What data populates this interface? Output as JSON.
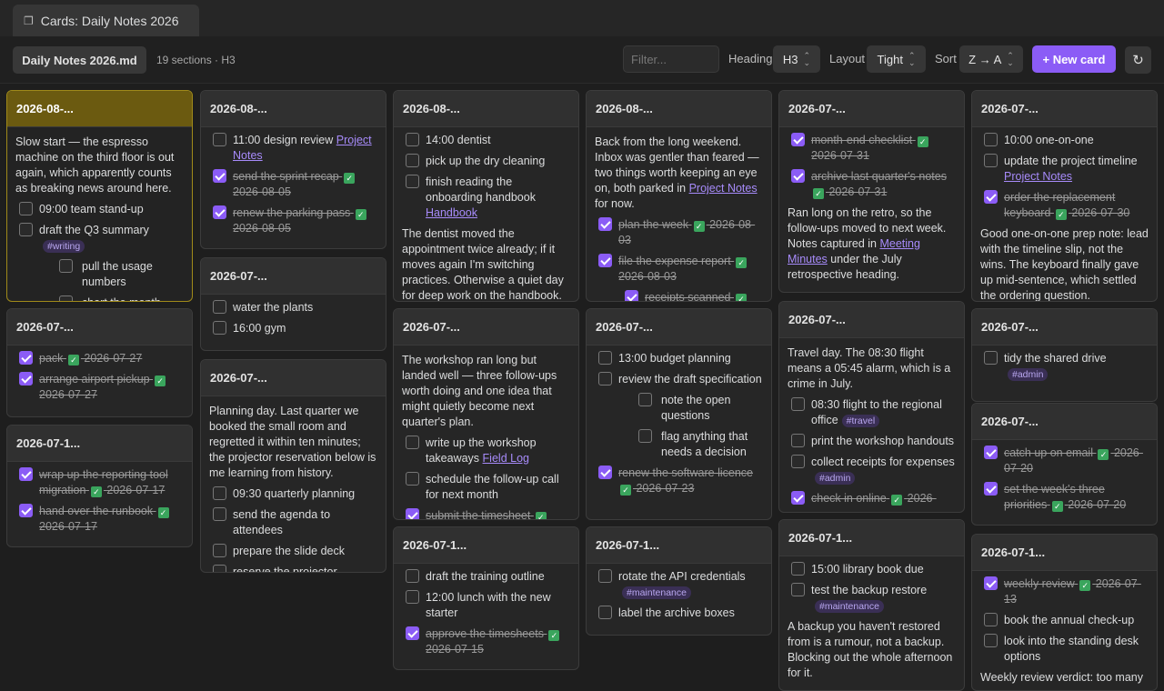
{
  "tab": {
    "icon": "copy-icon",
    "title": "Cards: Daily Notes 2026"
  },
  "toolbar": {
    "file": "Daily Notes 2026.md",
    "meta": "19 sections · H3",
    "filter_placeholder": "Filter...",
    "heading_label": "Heading",
    "heading_value": "H3",
    "layout_label": "Layout",
    "layout_value": "Tight",
    "sort_label": "Sort",
    "sort_value": "Z → A",
    "new_card": "+ New card",
    "refresh_icon": "↻"
  },
  "colors": {
    "accent": "#8b5cf6",
    "selected_head": "#6b5a10",
    "done_check": "#3aa55d"
  },
  "cards": [
    {
      "title": "2026-08-...",
      "selected": true,
      "items": [
        {
          "t": "p",
          "text": "Slow start — the espresso machine on the third floor is out again, which apparently counts as breaking news around here."
        },
        {
          "t": "task",
          "text": "09:00 team stand-up"
        },
        {
          "t": "task",
          "text": "draft the Q3 summary",
          "tag": "#writing"
        },
        {
          "t": "task",
          "lvl": 2,
          "text": "pull the usage numbers"
        },
        {
          "t": "task",
          "lvl": 2,
          "text": "chart the month"
        }
      ]
    },
    {
      "title": "2026-07-...",
      "items": [
        {
          "t": "task",
          "done": true,
          "text": "pack",
          "date": "2026-07-27"
        },
        {
          "t": "task",
          "done": true,
          "text": "arrange airport pickup",
          "date": "2026-07-27"
        }
      ]
    },
    {
      "title": "2026-07-1...",
      "items": [
        {
          "t": "task",
          "done": true,
          "text": "wrap up the reporting tool migration",
          "date": "2026-07-17"
        },
        {
          "t": "task",
          "done": true,
          "text": "hand over the runbook",
          "date": "2026-07-17"
        }
      ]
    },
    {
      "title": "2026-08-...",
      "items": [
        {
          "t": "task",
          "text": "11:00 design review",
          "link": "Project Notes"
        },
        {
          "t": "task",
          "done": true,
          "text": "send the sprint recap",
          "date": "2026-08-05"
        },
        {
          "t": "task",
          "done": true,
          "text": "renew the parking pass",
          "date": "2026-08-05"
        }
      ]
    },
    {
      "title": "2026-07-...",
      "items": [
        {
          "t": "task",
          "text": "water the plants"
        },
        {
          "t": "task",
          "text": "16:00 gym"
        }
      ]
    },
    {
      "title": "2026-07-...",
      "items": [
        {
          "t": "p",
          "text": "Planning day. Last quarter we booked the small room and regretted it within ten minutes; the projector reservation below is me learning from history."
        },
        {
          "t": "task",
          "text": "09:30 quarterly planning"
        },
        {
          "t": "task",
          "text": "send the agenda to attendees"
        },
        {
          "t": "task",
          "text": "prepare the slide deck"
        },
        {
          "t": "task",
          "text": "reserve the projector"
        }
      ]
    },
    {
      "title": "2026-08-...",
      "items": [
        {
          "t": "task",
          "text": "14:00 dentist"
        },
        {
          "t": "task",
          "text": "pick up the dry cleaning"
        },
        {
          "t": "task",
          "text": "finish reading the onboarding handbook",
          "link": "Handbook"
        },
        {
          "t": "p",
          "text": "The dentist moved the appointment twice already; if it moves again I'm switching practices. Otherwise a quiet day for deep work on the handbook."
        }
      ]
    },
    {
      "title": "2026-07-...",
      "items": [
        {
          "t": "p",
          "text": "The workshop ran long but landed well — three follow-ups worth doing and one idea that might quietly become next quarter's plan."
        },
        {
          "t": "task",
          "text": "write up the workshop takeaways",
          "link": "Field Log"
        },
        {
          "t": "task",
          "text": "schedule the follow-up call for next month"
        },
        {
          "t": "task",
          "done": true,
          "text": "submit the timesheet"
        }
      ]
    },
    {
      "title": "2026-07-1...",
      "items": [
        {
          "t": "task",
          "text": "draft the training outline"
        },
        {
          "t": "task",
          "text": "12:00 lunch with the new starter"
        },
        {
          "t": "task",
          "done": true,
          "text": "approve the timesheets",
          "date": "2026-07-15"
        }
      ]
    },
    {
      "title": "2026-08-...",
      "items": [
        {
          "t": "p",
          "text": "Back from the long weekend. Inbox was gentler than feared — two things worth keeping an eye on, both parked in",
          "link": "Project Notes",
          "after": " for now."
        },
        {
          "t": "task",
          "done": true,
          "text": "plan the week",
          "date": "2026-08-03"
        },
        {
          "t": "task",
          "done": true,
          "text": "file the expense report",
          "date": "2026-08-03"
        },
        {
          "t": "task",
          "lvl": 3,
          "done": true,
          "text": "receipts scanned"
        }
      ]
    },
    {
      "title": "2026-07-...",
      "items": [
        {
          "t": "task",
          "text": "13:00 budget planning"
        },
        {
          "t": "task",
          "text": "review the draft specification"
        },
        {
          "t": "task",
          "lvl": 2,
          "text": "note the open questions"
        },
        {
          "t": "task",
          "lvl": 2,
          "text": "flag anything that needs a decision"
        },
        {
          "t": "task",
          "done": true,
          "text": "renew the software licence",
          "date": "2026-07-23"
        }
      ]
    },
    {
      "title": "2026-07-1...",
      "items": [
        {
          "t": "task",
          "text": "rotate the API credentials",
          "tag": "#maintenance"
        },
        {
          "t": "task",
          "text": "label the archive boxes"
        }
      ]
    },
    {
      "title": "2026-07-...",
      "items": [
        {
          "t": "task",
          "done": true,
          "text": "month-end checklist",
          "date": "2026-07-31"
        },
        {
          "t": "task",
          "done": true,
          "text": "archive last quarter's notes",
          "date": "2026-07-31"
        },
        {
          "t": "p",
          "text": "Ran long on the retro, so the follow-ups moved to next week. Notes captured in",
          "link": "Meeting Minutes",
          "after": " under the July retrospective heading."
        }
      ]
    },
    {
      "title": "2026-07-...",
      "items": [
        {
          "t": "p",
          "text": "Travel day. The 08:30 flight means a 05:45 alarm, which is a crime in July."
        },
        {
          "t": "task",
          "text": "08:30 flight to the regional office",
          "tag": "#travel"
        },
        {
          "t": "task",
          "text": "print the workshop handouts"
        },
        {
          "t": "task",
          "text": "collect receipts for expenses",
          "tag": "#admin"
        },
        {
          "t": "task",
          "done": true,
          "text": "check in online",
          "date": "2026-"
        }
      ]
    },
    {
      "title": "2026-07-1...",
      "items": [
        {
          "t": "task",
          "text": "15:00 library book due"
        },
        {
          "t": "task",
          "text": "test the backup restore",
          "tag": "#maintenance"
        },
        {
          "t": "p",
          "text": "A backup you haven't restored from is a rumour, not a backup. Blocking out the whole afternoon for it."
        }
      ]
    },
    {
      "title": "2026-07-...",
      "items": [
        {
          "t": "task",
          "text": "10:00 one-on-one"
        },
        {
          "t": "task",
          "text": "update the project timeline",
          "link": "Project Notes"
        },
        {
          "t": "task",
          "done": true,
          "text": "order the replacement keyboard",
          "date": "2026-07-30"
        },
        {
          "t": "p",
          "text": "Good one-on-one prep note: lead with the timeline slip, not the wins. The keyboard finally gave up mid-sentence, which settled the ordering question."
        }
      ]
    },
    {
      "title": "2026-07-...",
      "items": [
        {
          "t": "task",
          "text": "tidy the shared drive",
          "tag": "#admin"
        }
      ]
    },
    {
      "title": "2026-07-...",
      "items": [
        {
          "t": "task",
          "done": true,
          "text": "catch up on email",
          "date": "2026-07-20"
        },
        {
          "t": "task",
          "done": true,
          "text": "set the week's three priorities",
          "date": "2026-07-20"
        }
      ]
    },
    {
      "title": "2026-07-1...",
      "items": [
        {
          "t": "task",
          "done": true,
          "text": "weekly review",
          "date": "2026-07-13"
        },
        {
          "t": "task",
          "text": "book the annual check-up"
        },
        {
          "t": "task",
          "text": "look into the standing desk options"
        },
        {
          "t": "p",
          "text": "Weekly review verdict: too many"
        }
      ]
    }
  ]
}
